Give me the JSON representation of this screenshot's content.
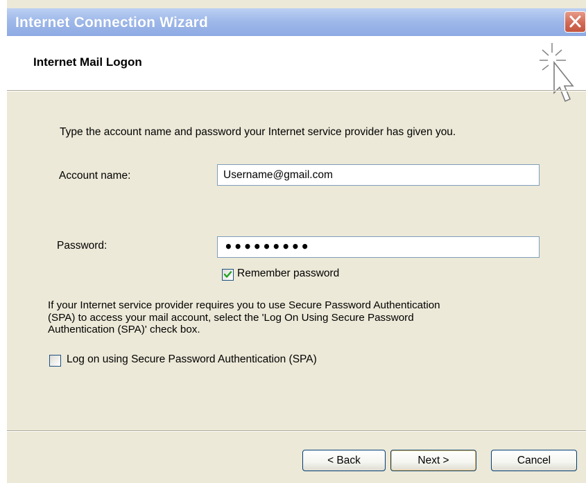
{
  "window": {
    "title": "Internet Connection Wizard",
    "close_icon": "close-icon"
  },
  "header": {
    "title": "Internet Mail Logon",
    "icon": "wizard-cursor-icon"
  },
  "form": {
    "instruction": "Type the account name and password your Internet service provider has given you.",
    "account_label": "Account name:",
    "account_value": "Username@gmail.com",
    "password_label": "Password:",
    "password_value": "•••••••••",
    "remember_label": "Remember password",
    "remember_checked": true,
    "spa_note_lines": [
      "If your Internet service provider requires you to use Secure Password Authentication",
      "(SPA) to access your mail account, select the 'Log On Using Secure Password",
      "Authentication (SPA)' check box."
    ],
    "spa_label": "Log on using Secure Password Authentication (SPA)",
    "spa_checked": false
  },
  "buttons": {
    "back": "< Back",
    "next": "Next >",
    "cancel": "Cancel"
  },
  "colors": {
    "titlebar": "#9fb9ea",
    "close": "#d26a55",
    "dialog_bg": "#ece9d8",
    "checkmark": "#21a121"
  }
}
